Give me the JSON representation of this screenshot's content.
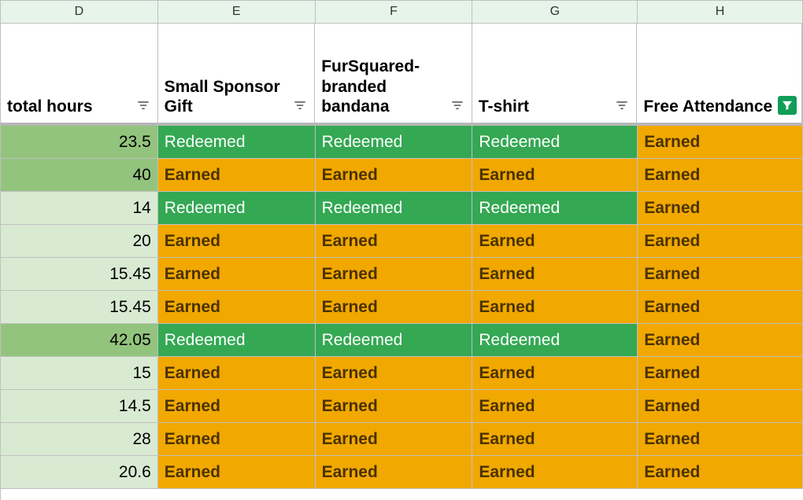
{
  "columns": [
    {
      "letter": "D",
      "header": "total hours",
      "filter": "normal",
      "key": "hours"
    },
    {
      "letter": "E",
      "header": "Small Sponsor Gift",
      "filter": "normal",
      "key": "gift"
    },
    {
      "letter": "F",
      "header": "FurSquared-branded bandana",
      "filter": "normal",
      "key": "bandana"
    },
    {
      "letter": "G",
      "header": "T-shirt",
      "filter": "normal",
      "key": "tshirt"
    },
    {
      "letter": "H",
      "header": "Free Attendance",
      "filter": "active",
      "key": "attend"
    }
  ],
  "rows": [
    {
      "hours": "23.5",
      "gift": "Redeemed",
      "bandana": "Redeemed",
      "tshirt": "Redeemed",
      "attend": "Earned",
      "dark": true
    },
    {
      "hours": "40",
      "gift": "Earned",
      "bandana": "Earned",
      "tshirt": "Earned",
      "attend": "Earned",
      "dark": true
    },
    {
      "hours": "14",
      "gift": "Redeemed",
      "bandana": "Redeemed",
      "tshirt": "Redeemed",
      "attend": "Earned",
      "dark": false
    },
    {
      "hours": "20",
      "gift": "Earned",
      "bandana": "Earned",
      "tshirt": "Earned",
      "attend": "Earned",
      "dark": false
    },
    {
      "hours": "15.45",
      "gift": "Earned",
      "bandana": "Earned",
      "tshirt": "Earned",
      "attend": "Earned",
      "dark": false
    },
    {
      "hours": "15.45",
      "gift": "Earned",
      "bandana": "Earned",
      "tshirt": "Earned",
      "attend": "Earned",
      "dark": false
    },
    {
      "hours": "42.05",
      "gift": "Redeemed",
      "bandana": "Redeemed",
      "tshirt": "Redeemed",
      "attend": "Earned",
      "dark": true
    },
    {
      "hours": "15",
      "gift": "Earned",
      "bandana": "Earned",
      "tshirt": "Earned",
      "attend": "Earned",
      "dark": false
    },
    {
      "hours": "14.5",
      "gift": "Earned",
      "bandana": "Earned",
      "tshirt": "Earned",
      "attend": "Earned",
      "dark": false
    },
    {
      "hours": "28",
      "gift": "Earned",
      "bandana": "Earned",
      "tshirt": "Earned",
      "attend": "Earned",
      "dark": false
    },
    {
      "hours": "20.6",
      "gift": "Earned",
      "bandana": "Earned",
      "tshirt": "Earned",
      "attend": "Earned",
      "dark": false
    }
  ],
  "chart_data": {
    "type": "table",
    "columns": [
      "total hours",
      "Small Sponsor Gift",
      "FurSquared-branded bandana",
      "T-shirt",
      "Free Attendance"
    ],
    "rows": [
      [
        23.5,
        "Redeemed",
        "Redeemed",
        "Redeemed",
        "Earned"
      ],
      [
        40,
        "Earned",
        "Earned",
        "Earned",
        "Earned"
      ],
      [
        14,
        "Redeemed",
        "Redeemed",
        "Redeemed",
        "Earned"
      ],
      [
        20,
        "Earned",
        "Earned",
        "Earned",
        "Earned"
      ],
      [
        15.45,
        "Earned",
        "Earned",
        "Earned",
        "Earned"
      ],
      [
        15.45,
        "Earned",
        "Earned",
        "Earned",
        "Earned"
      ],
      [
        42.05,
        "Redeemed",
        "Redeemed",
        "Redeemed",
        "Earned"
      ],
      [
        15,
        "Earned",
        "Earned",
        "Earned",
        "Earned"
      ],
      [
        14.5,
        "Earned",
        "Earned",
        "Earned",
        "Earned"
      ],
      [
        28,
        "Earned",
        "Earned",
        "Earned",
        "Earned"
      ],
      [
        20.6,
        "Earned",
        "Earned",
        "Earned",
        "Earned"
      ]
    ]
  }
}
